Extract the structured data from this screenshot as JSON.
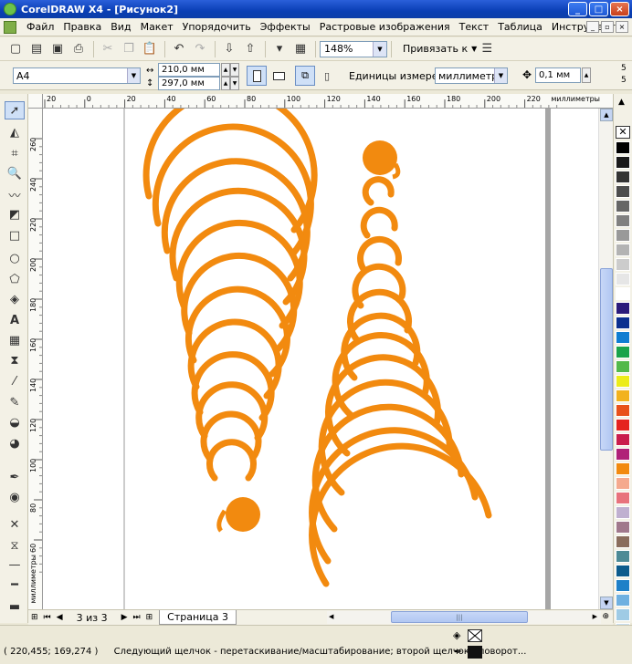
{
  "window": {
    "title": "CorelDRAW X4 - [Рисунок2]",
    "buttons": [
      "_",
      "□",
      "×"
    ]
  },
  "menu": {
    "items": [
      "Файл",
      "Правка",
      "Вид",
      "Макет",
      "Упорядочить",
      "Эффекты",
      "Растровые изображения",
      "Текст",
      "Таблица",
      "Инструменты"
    ],
    "right_buttons": [
      "_",
      "▫",
      "×"
    ]
  },
  "toolbar": {
    "zoom": "148%",
    "snap_label": "Привязать к"
  },
  "property_bar": {
    "paper_size": "A4",
    "width": "210,0 мм",
    "height": "297,0 мм",
    "units_label": "Единицы измерения:",
    "units_value": "миллиметры",
    "nudge": "0,1 мм",
    "dup_offsets": [
      "5",
      "5"
    ]
  },
  "rulers": {
    "h_ticks": [
      "20",
      "0",
      "20",
      "40",
      "60",
      "80",
      "100",
      "120",
      "140",
      "160",
      "180",
      "200",
      "220"
    ],
    "h_unit": "миллиметры",
    "v_ticks": [
      "260",
      "240",
      "220",
      "200",
      "180",
      "160",
      "140",
      "120",
      "100",
      "80",
      "60"
    ],
    "v_unit": "миллиметры"
  },
  "page_nav": {
    "counter": "3 из 3",
    "tab": "Страница 3"
  },
  "status": {
    "coords": "( 220,455; 169,274 )",
    "message": "Следующий щелчок - перетаскивание/масштабирование; второй щелчок - поворот..."
  },
  "colors": {
    "accent": "#f28a0f",
    "palette": [
      "#000000",
      "#1a1a1a",
      "#333333",
      "#4d4d4d",
      "#666666",
      "#808080",
      "#999999",
      "#b3b3b3",
      "#cccccc",
      "#e6e6e6",
      "#ffffff",
      "#2b1b7a",
      "#0b2f8f",
      "#0f7dd1",
      "#1aa34a",
      "#52b94a",
      "#ecec19",
      "#f2b21e",
      "#e8511a",
      "#e5231e",
      "#c91d4d",
      "#b02278",
      "#f28a0f",
      "#f5a98e",
      "#e8727c",
      "#c0b0d0",
      "#a0788c",
      "#8a6d5c",
      "#4d8a96",
      "#0c5b8c",
      "#1e80c8",
      "#6fb0e0",
      "#9fcbe5",
      "#c8dff0"
    ]
  }
}
